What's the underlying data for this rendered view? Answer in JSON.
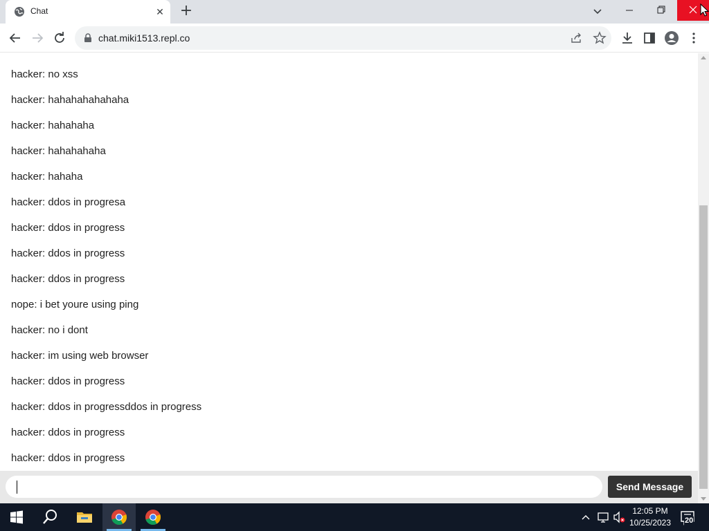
{
  "browser": {
    "tab_title": "Chat",
    "tab_close": "✕",
    "new_tab": "+",
    "url": "chat.miki1513.repl.co"
  },
  "chat": {
    "messages": [
      "hacker: no xss",
      "hacker: hahahahahahaha",
      "hacker: hahahaha",
      "hacker: hahahahaha",
      "hacker: hahaha",
      "hacker: ddos in progresa",
      "hacker: ddos in progress",
      "hacker: ddos in progress",
      "hacker: ddos in progress",
      "nope: i bet youre using ping",
      "hacker: no i dont",
      "hacker: im using web browser",
      "hacker: ddos in progress",
      "hacker: ddos in progressddos in progress",
      "hacker: ddos in progress",
      "hacker: ddos in progress"
    ],
    "input_value": "",
    "send_label": "Send Message"
  },
  "taskbar": {
    "time": "12:05 PM",
    "date": "10/25/2023",
    "notification_count": "20"
  },
  "colors": {
    "close_button": "#e81123",
    "send_button": "#333333",
    "taskbar": "#101826"
  },
  "icons": [
    "globe-icon",
    "close-icon",
    "plus-icon",
    "chevron-down-icon",
    "minimize-icon",
    "restore-icon",
    "back-icon",
    "forward-icon",
    "reload-icon",
    "lock-icon",
    "share-icon",
    "star-icon",
    "download-icon",
    "side-panel-icon",
    "profile-icon",
    "menu-icon",
    "windows-start-icon",
    "search-icon",
    "file-explorer-icon",
    "chrome-icon",
    "chevron-up-icon",
    "network-icon",
    "volume-muted-icon",
    "notification-icon"
  ]
}
